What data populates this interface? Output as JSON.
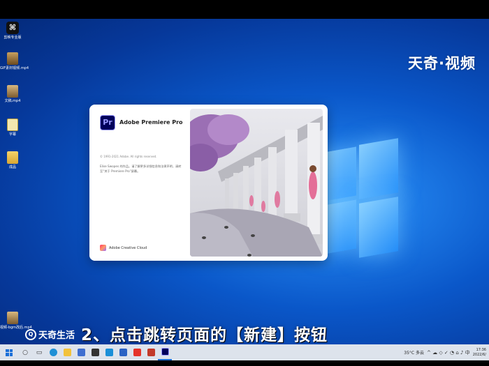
{
  "watermark": {
    "top_right": "天奇·视频"
  },
  "desktop_icons": [
    {
      "label": "剪映专业版",
      "icon": "capcut-icon",
      "glyph": "⌘"
    },
    {
      "label": "GIF素材视频.mp4",
      "icon": "video-file-icon"
    },
    {
      "label": "文稿.mp4",
      "icon": "video-file-icon"
    },
    {
      "label": "字幕",
      "icon": "document-icon"
    },
    {
      "label": "成品",
      "icon": "folder-icon"
    },
    {
      "label": "视频-bgm改后.mp4",
      "icon": "video-file-icon"
    }
  ],
  "splash": {
    "logo_text": "Pr",
    "app_name": "Adobe Premiere Pro",
    "copyright": "© 1991-2021 Adobe. All rights reserved.",
    "credits": "Elise Swopes 的作品。请了解更多详细信息和法律声明，请转至“关于 Premiere Pro”屏幕。",
    "cc_label": "Adobe Creative Cloud"
  },
  "branding": {
    "icon_text": "Q",
    "name": "天奇生活"
  },
  "subtitle": "2、点击跳转页面的【新建】按钮",
  "taskbar": {
    "apps": [
      {
        "icon": "search-icon",
        "glyph": "○"
      },
      {
        "icon": "task-view-icon",
        "glyph": "▭"
      },
      {
        "icon": "edge-icon",
        "color": "#1e90d6"
      },
      {
        "icon": "explorer-icon",
        "color": "#f2c23c"
      },
      {
        "icon": "store-icon",
        "color": "#3f6fd0"
      },
      {
        "icon": "app-icon",
        "color": "#333333"
      },
      {
        "icon": "app-icon",
        "color": "#1a8fd8"
      },
      {
        "icon": "app-icon",
        "color": "#2a62c4"
      },
      {
        "icon": "wps-icon",
        "color": "#e5332a"
      },
      {
        "icon": "app-icon",
        "color": "#c23a2a"
      },
      {
        "icon": "premiere-icon",
        "color": "#00005b"
      }
    ],
    "weather": "35°C 多云",
    "sys_icons": "^ ☁ ◇ ✓ ◔ ⌂ ♪ 中",
    "clock_time": "17:36",
    "clock_date": "2022/6/"
  }
}
